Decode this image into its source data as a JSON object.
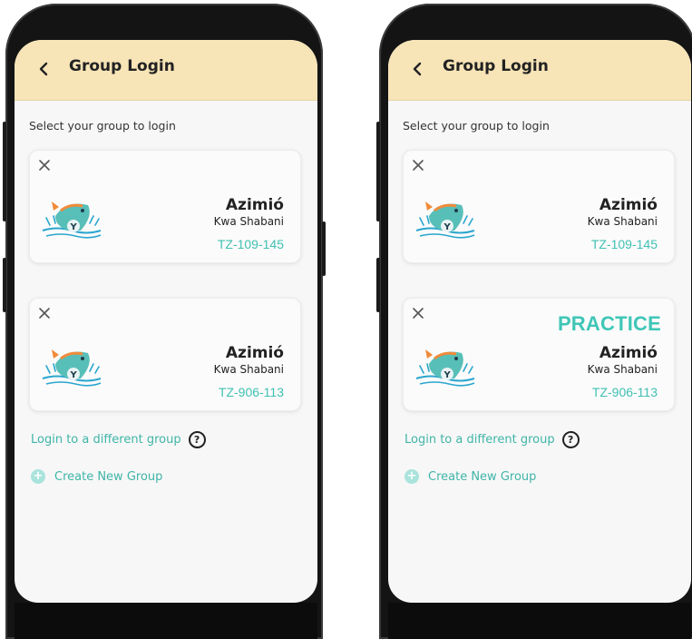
{
  "screens": [
    {
      "header": {
        "title": "Group Login"
      },
      "subtitle": "Select your group to login",
      "cards": [
        {
          "name": "Azimió",
          "sub": "Kwa Shabani",
          "code": "TZ-109-145"
        },
        {
          "name": "Azimió",
          "sub": "Kwa Shabani",
          "code": "TZ-906-113"
        }
      ],
      "login_link": "Login to a different group",
      "create_link": "Create New Group"
    },
    {
      "header": {
        "title": "Group Login"
      },
      "subtitle": "Select your group to login",
      "cards": [
        {
          "name": "Azimió",
          "sub": "Kwa Shabani",
          "code": "TZ-109-145"
        },
        {
          "badge": "PRACTICE",
          "name": "Azimió",
          "sub": "Kwa Shabani",
          "code": "TZ-906-113"
        }
      ],
      "login_link": "Login to a different group",
      "create_link": "Create New Group"
    }
  ],
  "icons": {
    "back": "chevron-left-icon",
    "close": "close-icon",
    "logo": "fish-logo-icon",
    "help": "question-circle-icon",
    "add": "plus-circle-icon"
  },
  "colors": {
    "header_bg": "#f7e4b7",
    "accent_teal": "#3fc0b2",
    "screen_bg": "#f7f7f7",
    "phone_frame": "#141414"
  },
  "help_glyph": "?",
  "add_glyph": "+"
}
